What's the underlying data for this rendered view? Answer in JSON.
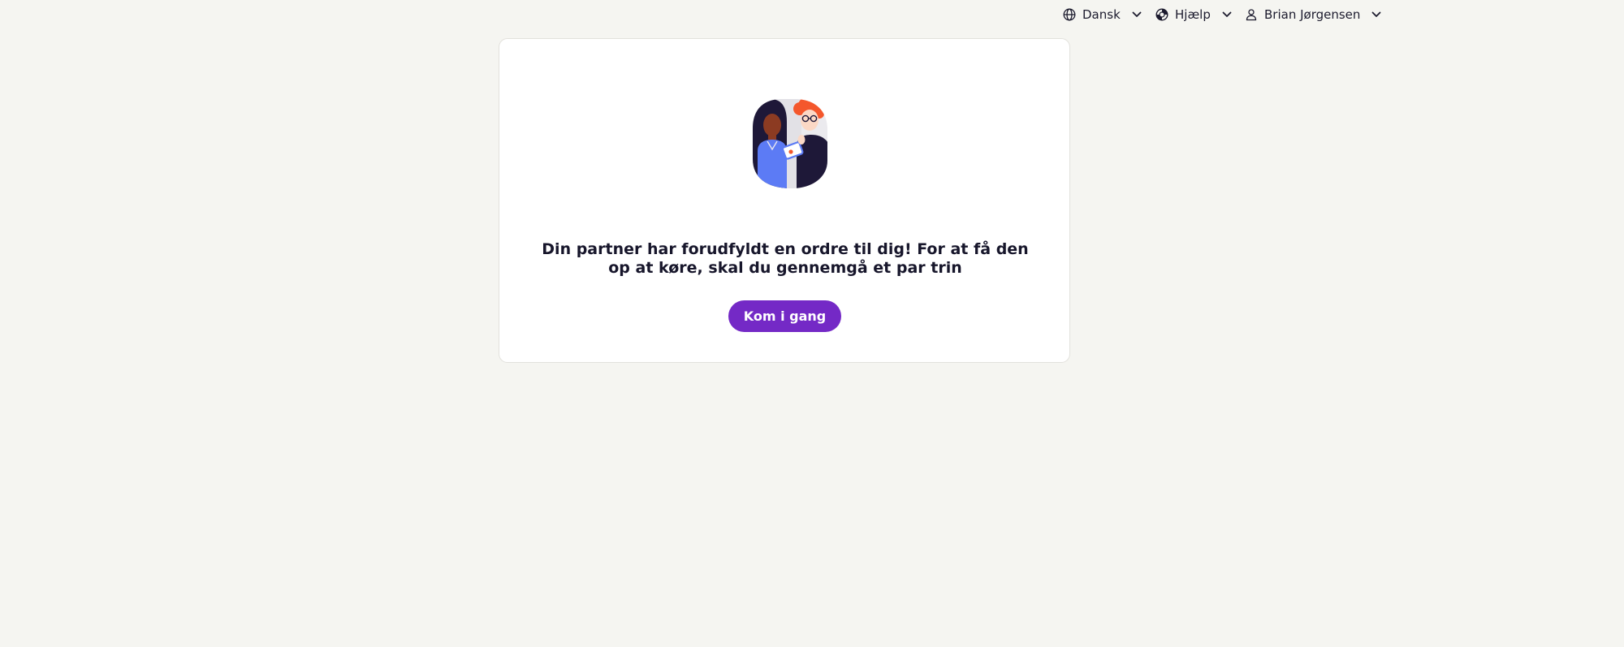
{
  "header": {
    "language": {
      "label": "Dansk",
      "icon": "globe-icon"
    },
    "help": {
      "label": "Hjælp",
      "icon": "lifebuoy-icon"
    },
    "user": {
      "label": "Brian Jørgensen",
      "icon": "person-icon"
    }
  },
  "main": {
    "message": "Din partner har forudfyldt en ordre til dig! For at få den op at køre, skal du gennemgå et par trin",
    "cta_label": "Kom i gang"
  },
  "colors": {
    "page_background": "#f5f5f1",
    "card_background": "#ffffff",
    "primary_button": "#7429c6",
    "text": "#17162b"
  }
}
